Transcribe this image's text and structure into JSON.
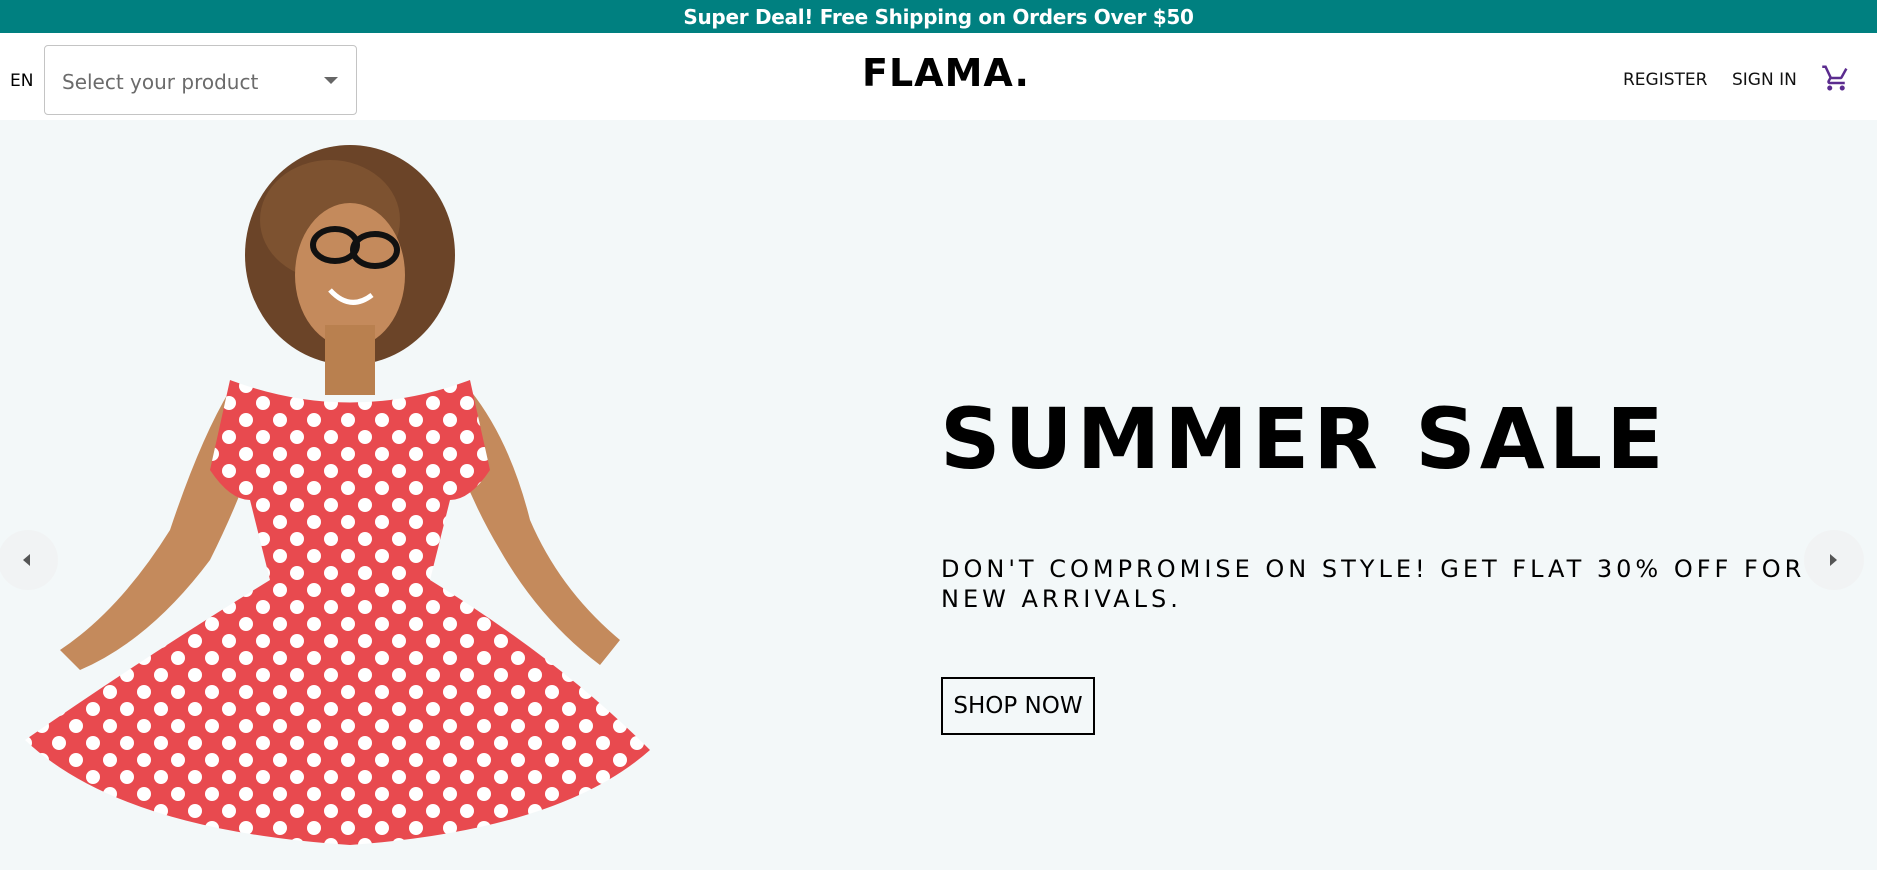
{
  "announcement": {
    "text": "Super Deal! Free Shipping on Orders Over $50",
    "bg_color": "#008080"
  },
  "header": {
    "language": "EN",
    "product_select": {
      "placeholder": "Select your product"
    },
    "logo": "FLAMA.",
    "links": {
      "register": "REGISTER",
      "sign_in": "SIGN IN"
    },
    "cart_icon": "shopping-cart-icon",
    "cart_color": "#5b2c8f"
  },
  "hero": {
    "title": "SUMMER SALE",
    "description": "DON'T COMPROMISE ON STYLE! GET FLAT 30% OFF FOR NEW ARRIVALS.",
    "button_label": "SHOP NOW",
    "bg_color": "#f3f8f9",
    "image": "woman-in-red-polka-dot-dress",
    "arrows": {
      "left": "arrow-left-icon",
      "right": "arrow-right-icon"
    }
  }
}
